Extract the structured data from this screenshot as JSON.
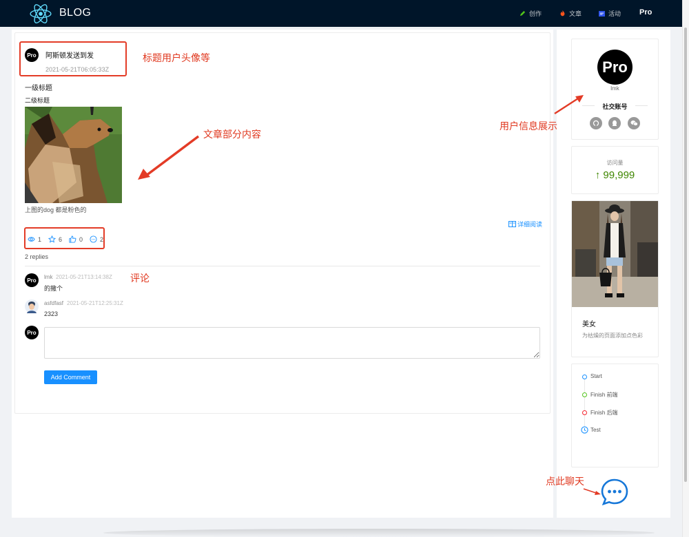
{
  "header": {
    "brand": "BLOG",
    "nav": [
      {
        "label": "创作",
        "icon": "pencil-icon",
        "color": "#52c41a"
      },
      {
        "label": "文章",
        "icon": "fire-icon",
        "color": "#fa541c"
      },
      {
        "label": "活动",
        "icon": "calendar-icon",
        "color": "#2f54eb"
      }
    ],
    "pro_label": "Pro",
    "bg_color": "#001529"
  },
  "post": {
    "avatar_text": "Pro",
    "title": "阿斯顿发送到发",
    "time": "2021-05-21T06:05:33Z",
    "h1": "一级标题",
    "h2": "二级标题",
    "image_caption": "上图的dog 都是粉色的",
    "read_more": "详细阅读",
    "stats": {
      "views": "1",
      "stars": "6",
      "likes": "0",
      "comments": "2"
    },
    "replies_label": "2 replies"
  },
  "comments": [
    {
      "avatar_text": "Pro",
      "author": "lmk",
      "time": "2021-05-21T13:14:38Z",
      "text": "的撒个"
    },
    {
      "avatar_text": "",
      "author": "asfdfasf",
      "time": "2021-05-21T12:25:31Z",
      "text": "2323"
    }
  ],
  "comment_form": {
    "avatar_text": "Pro",
    "placeholder": "",
    "button": "Add Comment"
  },
  "profile": {
    "avatar_text": "Pro",
    "name": "lmk",
    "social_title": "社交账号",
    "social_icons": [
      "github-icon",
      "qq-icon",
      "wechat-icon"
    ]
  },
  "visits": {
    "label": "访问量",
    "value": "99,999",
    "arrow": "↑",
    "color": "#3f8600"
  },
  "meta_card": {
    "title": "美女",
    "description": "为枯燥的页面添加点色彩"
  },
  "timeline": [
    {
      "label": "Start",
      "color": "#1890ff"
    },
    {
      "label": "Finish 前端",
      "color": "#52c41a"
    },
    {
      "label": "Finish 后端",
      "color": "#f5222d"
    },
    {
      "label": "Test",
      "color": "#1890ff",
      "icon": "clock-icon"
    }
  ],
  "annotations": {
    "title_area": "标题用户头像等",
    "article": "文章部分内容",
    "comments": "评论",
    "user_info": "用户信息展示",
    "chat": "点此聊天"
  },
  "colors": {
    "accent": "#1890ff",
    "annotation": "#e33b26"
  }
}
